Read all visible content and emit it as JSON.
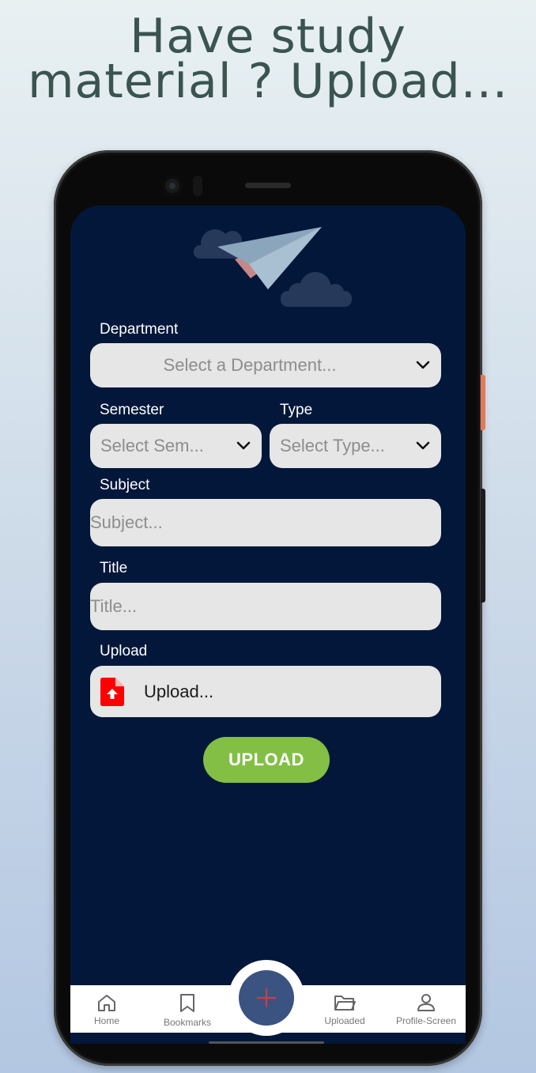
{
  "headline": {
    "line1": "Have study",
    "line2": "material ? Upload..."
  },
  "form": {
    "department": {
      "label": "Department",
      "placeholder": "Select a Department..."
    },
    "semester": {
      "label": "Semester",
      "placeholder": "Select Sem..."
    },
    "type": {
      "label": "Type",
      "placeholder": "Select Type..."
    },
    "subject": {
      "label": "Subject",
      "placeholder": "Subject..."
    },
    "title": {
      "label": "Title",
      "placeholder": "Title..."
    },
    "upload": {
      "label": "Upload",
      "text": "Upload...",
      "icon": "file-upload-icon",
      "icon_color": "#ff0000"
    },
    "submit_label": "UPLOAD"
  },
  "nav": {
    "items": [
      {
        "label": "Home",
        "icon": "home-icon"
      },
      {
        "label": "Bookmarks",
        "icon": "bookmark-icon"
      },
      {
        "label": "Uploaded",
        "icon": "folder-icon"
      },
      {
        "label": "Profile-Screen",
        "icon": "user-icon"
      }
    ],
    "fab_icon": "plus-icon"
  },
  "colors": {
    "screen_bg": "#03173a",
    "field_bg": "#e6e6e6",
    "submit_bg": "#82bf44",
    "fab_bg": "#3b5380",
    "fab_plus": "#d2384a",
    "headline": "#3a5450"
  }
}
